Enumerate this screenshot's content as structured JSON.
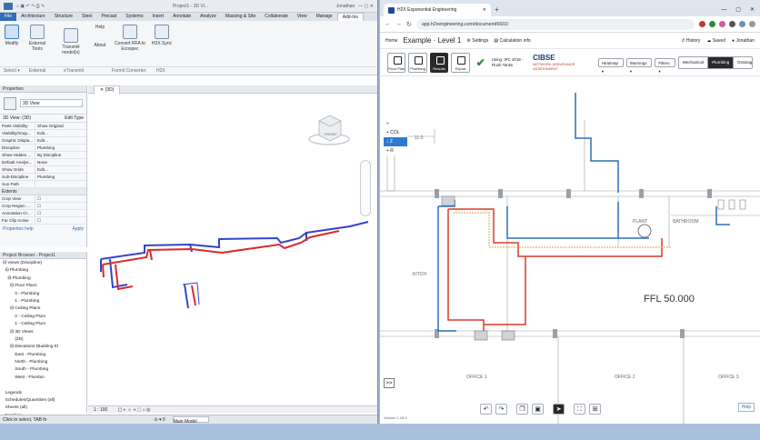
{
  "revit": {
    "title_center": "Project1 - 3D Vi...",
    "user": "Jonathan",
    "tabs": [
      "File",
      "Architecture",
      "Structure",
      "Steel",
      "Precast",
      "Systems",
      "Insert",
      "Annotate",
      "Analyze",
      "Massing & Site",
      "Collaborate",
      "View",
      "Manage",
      "Add-Ins"
    ],
    "ribbon": {
      "modify": "Modify",
      "external_tools": "External Tools",
      "transmit": "Transmit model(s)",
      "help": "Help",
      "about": "About",
      "convert": "Convert RFA to Ecospec",
      "h2x_sync": "H2X Sync",
      "groups": [
        "Select ▾",
        "External",
        "eTransmit",
        "Formit Converter",
        "H2X"
      ]
    },
    "properties": {
      "header": "Properties",
      "type": "3D View",
      "selector": "3D View: (3D)",
      "edit_type": "Edit Type",
      "rows": [
        [
          "Parts Visibility",
          "Show Original"
        ],
        [
          "Visibility/Grap...",
          "Edit..."
        ],
        [
          "Graphic Displa...",
          "Edit..."
        ],
        [
          "Discipline",
          "Plumbing"
        ],
        [
          "Show Hidden ...",
          "By Discipline"
        ],
        [
          "Default Analys...",
          "None"
        ],
        [
          "Show Grids",
          "Edit..."
        ],
        [
          "Sub-Discipline",
          "Plumbing"
        ],
        [
          "Sun Path",
          ""
        ]
      ],
      "extents_group": "Extents",
      "extents_rows": [
        [
          "Crop View",
          ""
        ],
        [
          "Crop Region ...",
          ""
        ],
        [
          "Annotation Cr...",
          ""
        ],
        [
          "Far Clip Active",
          ""
        ]
      ],
      "help_link": "Properties help",
      "apply": "Apply"
    },
    "browser": {
      "header": "Project Browser - Project1",
      "items": [
        "⊟ Views (Discipline)",
        "  ⊟ Plumbing",
        "    ⊟ Plumbing",
        "      ⊟ Floor Plans",
        "          0 - Plumbing",
        "          1 - Plumbing",
        "      ⊟ Ceiling Plans",
        "          0 - Ceiling Plum",
        "          1 - Ceiling Plum",
        "      ⊟ 3D Views",
        "          {3D}",
        "      ⊟ Elevations (Building El",
        "          East - Plumbing",
        "          North - Plumbing",
        "          South - Plumbing",
        "          West - Plumbin",
        "",
        "  Legends",
        "  Schedules/Quantities (all)",
        "  Sheets (all)",
        "  Families"
      ]
    },
    "view_tab": "{3D}",
    "view_scale": "1 : 100",
    "status": "Click to select, TAB fo",
    "main_model": "Main Model",
    "viewcube": "FRONT"
  },
  "browser_app": {
    "tab_title": "H2X Exponential Engineering",
    "new_tab": "+",
    "url": "app.h2xengineering.com/document/6931/",
    "home": "Home",
    "project": "Example · Level 1",
    "settings": "Settings",
    "calc_info": "Calculation info",
    "history": "History",
    "saved": "Saved",
    "user": "Jonathan",
    "tools": [
      "Floor Plan",
      "Plumbing",
      "Results",
      "Export"
    ],
    "standard": "Using: IPC 2018 - Flush Tanks",
    "cibse": "CIBSE",
    "cibse_sub": "NETWORK ASSURANCE ASSESSMENT",
    "dropdowns": [
      "Heatmap ▾",
      "Warnings ▾",
      "Filters ▾"
    ],
    "disciplines": [
      "Mechanical",
      "Plumbing",
      "Drainage"
    ],
    "side_controls": [
      "» ",
      "+ COL",
      "↕ Z",
      "+ R"
    ],
    "rooms": {
      "ffl": "FFL 50.000",
      "office1": "OFFICE 1",
      "office2": "OFFICE 2",
      "office3": "OFFICE 3",
      "kitch": "KITCH",
      "plant": "PLANT",
      "bathroom": "BATHROOM"
    },
    "dim": "11.0",
    "help": "Help",
    "version": "Version 1.18.4",
    "expand": ">>"
  }
}
